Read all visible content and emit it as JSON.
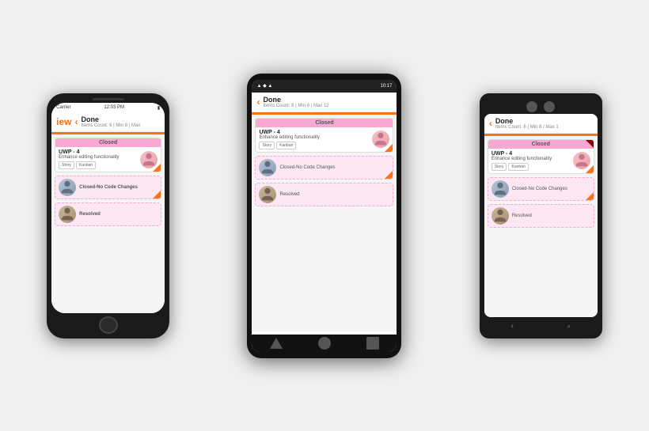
{
  "scene": {
    "bg": "#e8e8e8"
  },
  "iphone": {
    "carrier": "Carrier",
    "time": "12:03 PM",
    "header": {
      "back": "‹",
      "title": "Done",
      "subtitle": "Items Count: 6 | Min 8 | Max",
      "view": "iew"
    },
    "cards": [
      {
        "status": "Closed",
        "status_class": "status-closed",
        "title": "UWP - 4",
        "desc": "Enhance editing functionality",
        "tags": [
          "Story",
          "Kanban"
        ],
        "avatar_type": "female"
      },
      {
        "status": "Closed-No Code Changes",
        "status_class": "status-no-code",
        "avatar_type": "male"
      },
      {
        "status": "Resolved",
        "status_class": "status-resolved",
        "avatar_type": "male2"
      }
    ]
  },
  "android": {
    "time": "10:17",
    "header": {
      "back": "‹",
      "title": "Done",
      "subtitle": "Items Count: 8 | Min 8 | Max 12"
    },
    "cards": [
      {
        "status": "Closed",
        "status_class": "status-closed",
        "title": "UWP - 4",
        "desc": "Enhance editing functionality",
        "tags": [
          "Story",
          "Kanban"
        ],
        "avatar_type": "female"
      },
      {
        "status": "Closed-No Code Changes",
        "status_class": "status-no-code",
        "avatar_type": "male"
      },
      {
        "status": "Resolved",
        "status_class": "status-resolved",
        "avatar_type": "male2"
      }
    ]
  },
  "windows": {
    "header": {
      "back": "‹",
      "title": "Done",
      "subtitle": "Items Count :6 | Min 8 / Max 1"
    },
    "cards": [
      {
        "status": "Closed",
        "status_class": "status-closed",
        "title": "UWP - 4",
        "desc": "Enhance editing functionality",
        "tags": [
          "Story",
          "Kanban"
        ],
        "avatar_type": "female"
      },
      {
        "status": "Closed-No Code Changes",
        "status_class": "status-no-code",
        "avatar_type": "male"
      },
      {
        "status": "Resolved",
        "status_class": "status-resolved",
        "avatar_type": "male2"
      }
    ]
  },
  "labels": {
    "closed": "Closed",
    "no_code": "Closed-No Code Changes",
    "resolved": "Resolved",
    "uwp4": "UWP - 4",
    "desc": "Enhance editing functionality",
    "story": "Story",
    "kanban": "Kanban"
  }
}
